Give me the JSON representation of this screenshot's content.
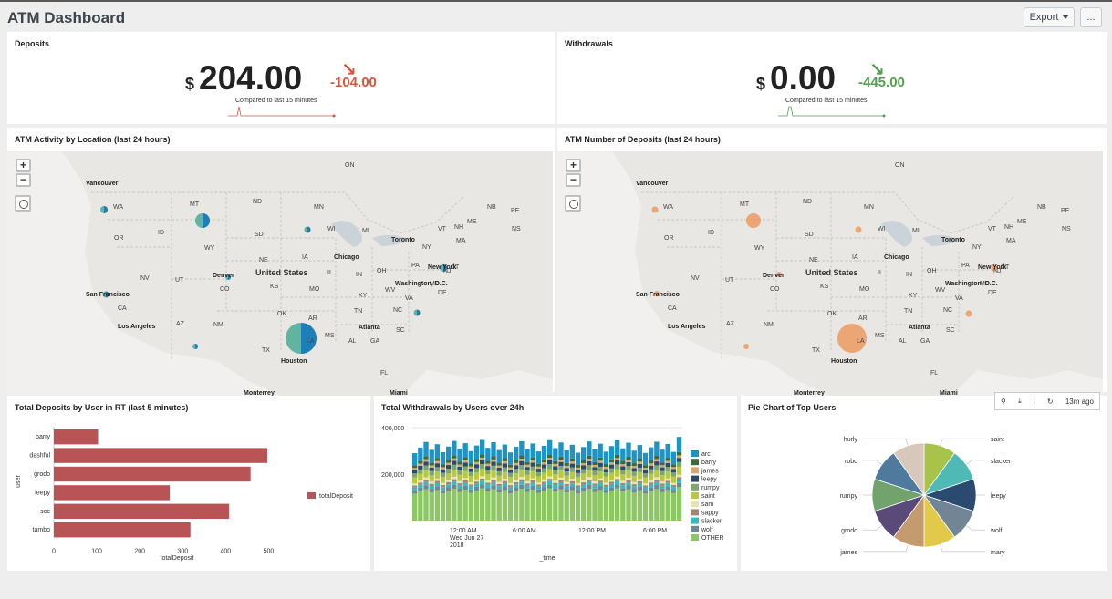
{
  "header": {
    "title": "ATM Dashboard",
    "export_label": "Export",
    "more_label": "..."
  },
  "deposits": {
    "title": "Deposits",
    "currency": "$",
    "value": "204.00",
    "delta": "-104.00",
    "delta_color": "#d6563c",
    "compare": "Compared to last 15 minutes"
  },
  "withdrawals": {
    "title": "Withdrawals",
    "currency": "$",
    "value": "0.00",
    "delta": "-445.00",
    "delta_color": "#53a051",
    "compare": "Compared to last 15 minutes"
  },
  "map_activity": {
    "title": "ATM Activity by Location (last 24 hours)"
  },
  "map_deposits": {
    "title": "ATM Number of Deposits (last 24 hours)"
  },
  "map_labels": {
    "provinces": [
      "ON",
      "WA",
      "MT",
      "ND",
      "MN",
      "WI",
      "MI",
      "ME",
      "NB",
      "PE",
      "NS",
      "OR",
      "ID",
      "SD",
      "WY",
      "NE",
      "IA",
      "NY",
      "VT",
      "NH",
      "MA",
      "NV",
      "UT",
      "CO",
      "KS",
      "IL",
      "IN",
      "OH",
      "PA",
      "CT",
      "NJ",
      "CA",
      "MO",
      "KY",
      "WV",
      "VA",
      "MD",
      "DE",
      "AZ",
      "NM",
      "OK",
      "AR",
      "TN",
      "NC",
      "SC",
      "MS",
      "AL",
      "GA",
      "TX",
      "LA",
      "FL"
    ],
    "cities": [
      "Vancouver",
      "Toronto",
      "Chicago",
      "New York",
      "Denver",
      "Washington, D.C.",
      "San Francisco",
      "Los Angeles",
      "Atlanta",
      "Houston",
      "Monterrey",
      "Miami"
    ],
    "country": "United States"
  },
  "bar_panel": {
    "title": "Total Deposits by User in RT (last 5 minutes)",
    "legend": "totalDeposit",
    "color": "#b85456"
  },
  "stack_panel": {
    "title": "Total Withdrawals by Users over 24h"
  },
  "pie_panel": {
    "title": "Pie Chart of Top Users"
  },
  "toolbar": {
    "age": "13m ago"
  },
  "chart_data": [
    {
      "type": "bar",
      "orientation": "horizontal",
      "categories": [
        "barry",
        "dashful",
        "grodo",
        "leepy",
        "soc",
        "tambo"
      ],
      "values": [
        103,
        497,
        458,
        270,
        408,
        318
      ],
      "xlabel": "totalDeposit",
      "ylabel": "user",
      "xlim": [
        0,
        550
      ],
      "xticks": [
        "0",
        "100",
        "200",
        "300",
        "400",
        "500"
      ],
      "legend": "right"
    },
    {
      "type": "bar",
      "stacked": true,
      "xlabel": "_time",
      "xticks": [
        "12:00 AM\nWed Jun 27\n2018",
        "6:00 AM",
        "12:00 PM",
        "6:00 PM"
      ],
      "yticks": [
        "200,000",
        "400,000"
      ],
      "ylim": [
        0,
        400000
      ],
      "legend": "right",
      "series": [
        {
          "name": "arc",
          "color": "#1e93c6"
        },
        {
          "name": "barry",
          "color": "#3c6b37"
        },
        {
          "name": "james",
          "color": "#d6a76e"
        },
        {
          "name": "leepy",
          "color": "#2c4a6b"
        },
        {
          "name": "rumpy",
          "color": "#7ba66e"
        },
        {
          "name": "saint",
          "color": "#b9c843"
        },
        {
          "name": "sam",
          "color": "#e8e2b6"
        },
        {
          "name": "sappy",
          "color": "#a08770"
        },
        {
          "name": "slacker",
          "color": "#38b8bf"
        },
        {
          "name": "wolf",
          "color": "#708794"
        },
        {
          "name": "OTHER",
          "color": "#8cc763"
        }
      ]
    },
    {
      "type": "pie",
      "series": [
        {
          "name": "saint",
          "value": 9,
          "color": "#a8c34a"
        },
        {
          "name": "slacker",
          "value": 9,
          "color": "#4fb9b5"
        },
        {
          "name": "leepy",
          "value": 9,
          "color": "#2b4a6f"
        },
        {
          "name": "wolf",
          "value": 9,
          "color": "#728595"
        },
        {
          "name": "mary",
          "value": 9,
          "color": "#e3c94a"
        },
        {
          "name": "james",
          "value": 9,
          "color": "#c49b6e"
        },
        {
          "name": "grodo",
          "value": 9,
          "color": "#5a4a7a"
        },
        {
          "name": "rumpy",
          "value": 9,
          "color": "#72a36c"
        },
        {
          "name": "robo",
          "value": 9,
          "color": "#4f7a9e"
        },
        {
          "name": "hurly",
          "value": 9,
          "color": "#d8c8bb"
        }
      ]
    }
  ]
}
